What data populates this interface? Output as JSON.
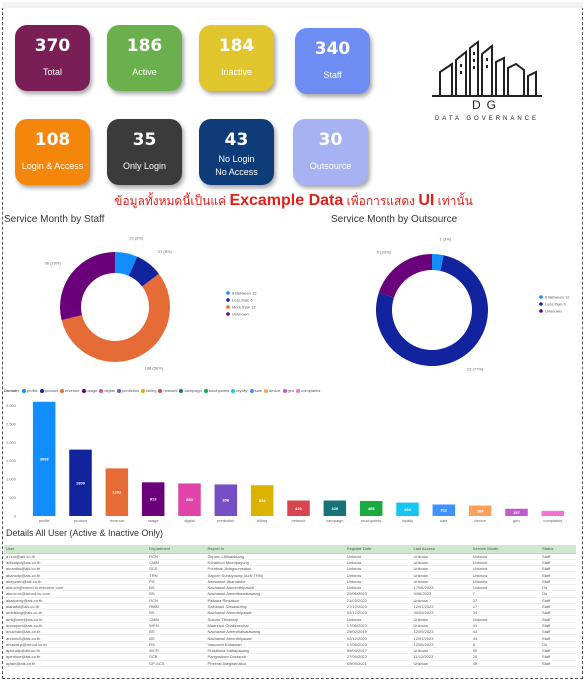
{
  "kpis": [
    {
      "value": "370",
      "label": "Total",
      "color": "#7a1f55"
    },
    {
      "value": "186",
      "label": "Active",
      "color": "#6ab04c"
    },
    {
      "value": "184",
      "label": "Inactive",
      "color": "#e1c52c"
    },
    {
      "value": "340",
      "label": "Staff",
      "color": "#6d8df2"
    },
    {
      "value": "108",
      "label": "Login & Access",
      "color": "#f5860c"
    },
    {
      "value": "35",
      "label": "Only Login",
      "color": "#3b3b3b"
    },
    {
      "value": "43",
      "label": "No Login\nNo Access",
      "color": "#0e3c78"
    },
    {
      "value": "30",
      "label": "Outsource",
      "color": "#a6b2f2"
    }
  ],
  "logo": {
    "initials": "DG",
    "name": "DATA GOVERNANCE"
  },
  "banner": {
    "pre": "ข้อมูลทั้งหมดนี้เป็นแค่ ",
    "highlight": "Excample Data",
    "mid": " เพื่อการแสดง ",
    "ui": "UI",
    "post": " เท่านั้น"
  },
  "staff_chart_title": "Service Month by Staff",
  "outsource_chart_title": "Service Month by Outsource",
  "bar_legend_title": "Domain",
  "table_title": "Details All User (Active & Inactive Only)",
  "colors": {
    "donut_blue": "#118dff",
    "donut_navy": "#12239e",
    "donut_orange": "#e66c37",
    "donut_purple": "#6b007b"
  },
  "chart_data": [
    {
      "type": "pie",
      "title": "Service Month by Staff",
      "labels": [
        "6 Between 12",
        "Less than 6",
        "More than 12",
        "Unknown"
      ],
      "values": [
        22,
        27,
        188,
        96
      ],
      "data_labels": [
        "22 (6%)",
        "27 (8%)",
        "188 (56%)",
        "96 (29%)"
      ],
      "colors": [
        "#118dff",
        "#12239e",
        "#e66c37",
        "#6b007b"
      ],
      "legend": "right"
    },
    {
      "type": "pie",
      "title": "Service Month by Outsource",
      "labels": [
        "6 Between 12",
        "Less than 6",
        "Unknown"
      ],
      "values": [
        1,
        23,
        6
      ],
      "data_labels": [
        "1 (3%)",
        "23 (77%)",
        "6 (20%)"
      ],
      "colors": [
        "#118dff",
        "#12239e",
        "#6b007b"
      ],
      "legend": "right"
    },
    {
      "type": "bar",
      "title": "",
      "categories": [
        "profile",
        "product",
        "revenue",
        "usage",
        "digital",
        "prediction",
        "billing",
        "network",
        "campaign",
        "touchpoints",
        "loyalty",
        "sale",
        "device",
        "geo",
        "complaints"
      ],
      "values": [
        3098,
        1800,
        1292,
        913,
        883,
        856,
        834,
        420,
        420,
        408,
        364,
        312,
        284,
        197,
        140
      ],
      "data_labels": [
        "3098",
        "1800",
        "1292",
        "913",
        "883",
        "856",
        "834",
        "420",
        "420",
        "408",
        "364",
        "312",
        "284",
        "197",
        ""
      ],
      "colors": [
        "#118dff",
        "#12239e",
        "#e66c37",
        "#6b007b",
        "#e044a7",
        "#744ec2",
        "#d9b300",
        "#d64550",
        "#197278",
        "#1aab40",
        "#15c6f4",
        "#4092ff",
        "#ffa058",
        "#be5dc9",
        "#f472d0"
      ],
      "yticks": [
        "3,000",
        "2,500",
        "2,000",
        "1,500",
        "1,000",
        "500",
        "0"
      ],
      "ylim": [
        0,
        3200
      ]
    }
  ],
  "table": {
    "headers": [
      "User",
      "Department",
      "Report to",
      "Register Date",
      "Last Access",
      "Service Month",
      "Status"
    ],
    "rows": [
      [
        "a.nuu@ais.co.th",
        "RCN",
        "Sirporn Lithsawdang",
        "Unknow",
        "Unknow",
        "Unknow",
        "Staff"
      ],
      [
        "adhudpd@ais.co.th",
        "CMM",
        "Korakhon Meenpayong",
        "Unknow",
        "Unknow",
        "Unknow",
        "Staff"
      ],
      [
        "ainanths@ais.co.th",
        "SCS",
        "Prenthat Jiningsumsakul",
        "Unknow",
        "Unknow",
        "Unknow",
        "Staff"
      ],
      [
        "akanodp@ais.co.th",
        "TRN",
        "Saporn Sunsiyoung (AcN TRN)",
        "Unknow",
        "Unknow",
        "Unknow",
        "Staff"
      ],
      [
        "akepomn@ais.co.th",
        "PS",
        "Aeewanut Jiilarnaidol",
        "Unknow",
        "Unknow",
        "Unknow",
        "Staff"
      ],
      [
        "akeoch@ximod.in.resource.com",
        "BS",
        "Nachawut Ameenthipawat",
        "Unknow",
        "17/06/2023",
        "Unknow",
        "Os"
      ],
      [
        "akeon.m@ximod.nc.com",
        "BS",
        "Nachawut Amenthawaiawang",
        "20/06/2023",
        "9/06/2023",
        "7",
        "Os"
      ],
      [
        "akaspeng@ais.co.th",
        "RCN",
        "Pattana Rinsakun",
        "21/03/2023",
        "Unknow",
        "27",
        "Staff"
      ],
      [
        "alahakd@ais.co.th",
        "RMM",
        "Sathinanl Sinsawuthip",
        "27/12/2023",
        "12/07/2023",
        "17",
        "Staff"
      ],
      [
        "ambikkng@ais.co.th",
        "BS",
        "Nachawut Amenthipawat",
        "02/12/2023",
        "30/09/2023",
        "34",
        "Staff"
      ],
      [
        "amighone@ais.co.th",
        "CMM",
        "Sukorn Thirdaroji",
        "Unknow",
        "Unknow",
        "Unknow",
        "Staff"
      ],
      [
        "anompimi@ais.co.th",
        "WPN",
        "Maanroui Chalitmechai",
        "17/06/2023",
        "Unknow",
        "41",
        "Staff"
      ],
      [
        "anuchab@ais.co.th",
        "BS",
        "Nachawut Amenthawaiawang",
        "29/02/2019",
        "12/09/2023",
        "44",
        "Staff"
      ],
      [
        "anurnich@ais.co.th",
        "BS",
        "Nachawut Amenthipawat",
        "02/12/2020",
        "12/07/2023",
        "34",
        "Staff"
      ],
      [
        "anuwat.p@ximod.co.th",
        "RS",
        "Vasuachi Edhawan",
        "17/06/2023",
        "12/09/2023",
        "8",
        "Os"
      ],
      [
        "apichaip@ais.co.th",
        "WCR",
        "Prasiltana Inatiapsuang",
        "09/04/2017",
        "Unknow",
        "90",
        "Staff"
      ],
      [
        "apinthoe@ais.co.th",
        "SCB",
        "Panguskom Dorasrok",
        "27/09/2022",
        "11/12/2023",
        "20",
        "Staff"
      ],
      [
        "apisin@ais.co.th",
        "DP-SCS",
        "Pheeral Jaegwenakul",
        "09/09/2021",
        "Unknow",
        "45",
        "Staff"
      ]
    ]
  }
}
